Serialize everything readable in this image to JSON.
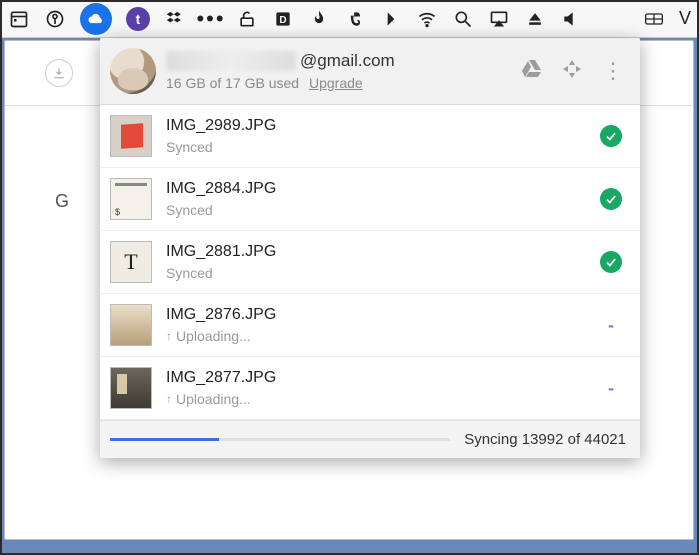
{
  "menubar": {
    "icons": [
      "calendar",
      "onepassword",
      "cloud",
      "tumblr",
      "dropbox",
      "more",
      "unlock",
      "docs",
      "backblaze",
      "evernote",
      "arrow",
      "wifi",
      "search",
      "airplay",
      "eject",
      "volume",
      "keyboard"
    ]
  },
  "background": {
    "sidebar_letter": "G"
  },
  "header": {
    "email_suffix": "@gmail.com",
    "storage_text": "16 GB of 17 GB used",
    "upgrade_label": "Upgrade"
  },
  "files": [
    {
      "name": "IMG_2989.JPG",
      "status_text": "Synced",
      "state": "synced",
      "thumb": "red"
    },
    {
      "name": "IMG_2884.JPG",
      "status_text": "Synced",
      "state": "synced",
      "thumb": "paper"
    },
    {
      "name": "IMG_2881.JPG",
      "status_text": "Synced",
      "state": "synced",
      "thumb": "news"
    },
    {
      "name": "IMG_2876.JPG",
      "status_text": "Uploading...",
      "state": "uploading",
      "thumb": "sepia"
    },
    {
      "name": "IMG_2877.JPG",
      "status_text": "Uploading...",
      "state": "uploading",
      "thumb": "darkp"
    }
  ],
  "footer": {
    "sync_text": "Syncing 13992 of 44021",
    "progress_percent": 32
  }
}
